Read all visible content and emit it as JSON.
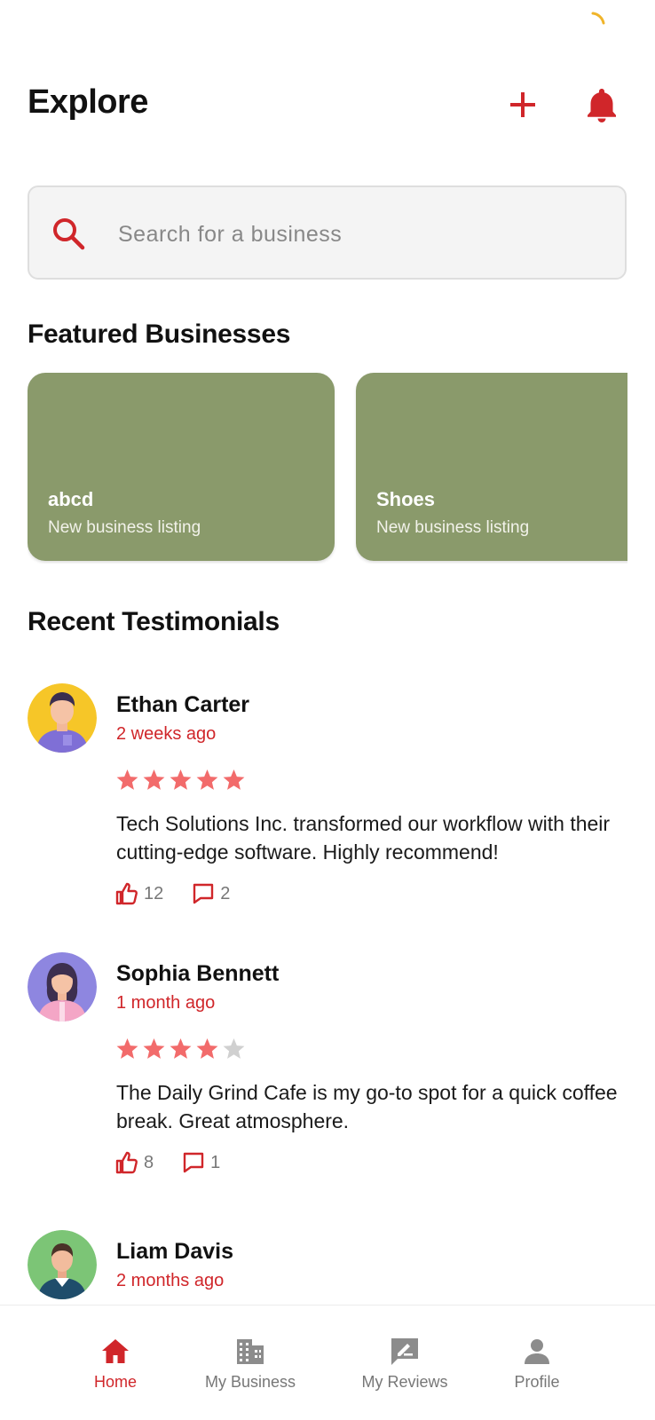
{
  "header": {
    "title": "Explore",
    "add_icon": "plus-icon",
    "notifications_icon": "bell-icon"
  },
  "search": {
    "placeholder": "Search for a business",
    "value": "",
    "icon": "search-icon"
  },
  "featured": {
    "title": "Featured Businesses",
    "cards": [
      {
        "name": "abcd",
        "subtitle": "New business listing"
      },
      {
        "name": "Shoes",
        "subtitle": "New business listing"
      }
    ]
  },
  "testimonials": {
    "title": "Recent Testimonials",
    "items": [
      {
        "name": "Ethan Carter",
        "time": "2 weeks ago",
        "rating": 5,
        "max_rating": 5,
        "text": "Tech Solutions Inc. transformed our workflow with their cutting-edge software. Highly recommend!",
        "likes": "12",
        "comments": "2"
      },
      {
        "name": "Sophia Bennett",
        "time": "1 month ago",
        "rating": 4,
        "max_rating": 5,
        "text": "The Daily Grind Cafe is my go-to spot for a quick coffee break. Great atmosphere.",
        "likes": "8",
        "comments": "1"
      },
      {
        "name": "Liam Davis",
        "time": "2 months ago"
      }
    ]
  },
  "bottom_nav": {
    "items": [
      {
        "label": "Home",
        "icon": "home-icon",
        "active": true
      },
      {
        "label": "My Business",
        "icon": "building-icon",
        "active": false
      },
      {
        "label": "My Reviews",
        "icon": "review-edit-icon",
        "active": false
      },
      {
        "label": "Profile",
        "icon": "person-icon",
        "active": false
      }
    ]
  },
  "colors": {
    "accent": "#d0262a",
    "card_bg": "#8a9a6b",
    "star_filled": "#f26b6b",
    "star_empty": "#d0d0d0",
    "nav_inactive": "#777777",
    "spinner": "#f0b429"
  }
}
